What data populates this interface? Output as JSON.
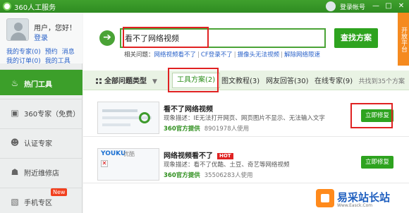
{
  "window": {
    "title": "360人工服务",
    "login_label": "登录帐号",
    "controls": [
      "—",
      "□",
      "✕"
    ]
  },
  "user": {
    "greeting": "用户，您好！",
    "login_link": "登录",
    "links_row1": [
      "我的专家(0)",
      "预约",
      "消息"
    ],
    "links_row2": [
      "我的订单(0)",
      "我的工具"
    ]
  },
  "sidebar": {
    "items": [
      {
        "label": "热门工具",
        "icon": "fire-icon",
        "active": true
      },
      {
        "label": "360专家（免费）",
        "icon": "monitor-icon",
        "active": false
      },
      {
        "label": "认证专家",
        "icon": "person-icon",
        "active": false
      },
      {
        "label": "附近维修店",
        "icon": "store-icon",
        "active": false
      },
      {
        "label": "手机专区",
        "icon": "phone-icon",
        "active": false,
        "badge": "New"
      }
    ]
  },
  "search": {
    "value": "看不了网络视频",
    "button": "查找方案",
    "related_label": "相关问题：",
    "related": [
      "网络视频看不了",
      "CF登录不了",
      "摄像头无法视频",
      "解除网络限速"
    ]
  },
  "promo": {
    "text": "开放平台"
  },
  "tabs": {
    "all_label": "全部问题类型",
    "items": [
      {
        "label": "工具方案(2)",
        "active": true
      },
      {
        "label": "图文教程(3)",
        "active": false
      },
      {
        "label": "网友回答(30)",
        "active": false
      },
      {
        "label": "在线专家(9)",
        "active": false
      }
    ],
    "summary": "共找到35个方案"
  },
  "results": [
    {
      "title": "看不了网络视频",
      "hot": false,
      "desc": "现象描述：IE无法打开网页、网页图片不显示、无法输入文字",
      "provider": "360官方提供",
      "users": "8901978人使用",
      "button": "立即修复"
    },
    {
      "title": "网络视频看不了",
      "hot": true,
      "hot_label": "HOT",
      "desc": "现象描述：看不了优酷、土豆、奇艺等网络视频",
      "provider": "360官方提供",
      "users": "35506283人使用",
      "button": "立即修复",
      "thumb_logo": "YOUKU",
      "thumb_logo_cn": "优酷"
    }
  ],
  "watermark": {
    "text": "易采站长站",
    "sub": "Www.Easck.Com"
  }
}
